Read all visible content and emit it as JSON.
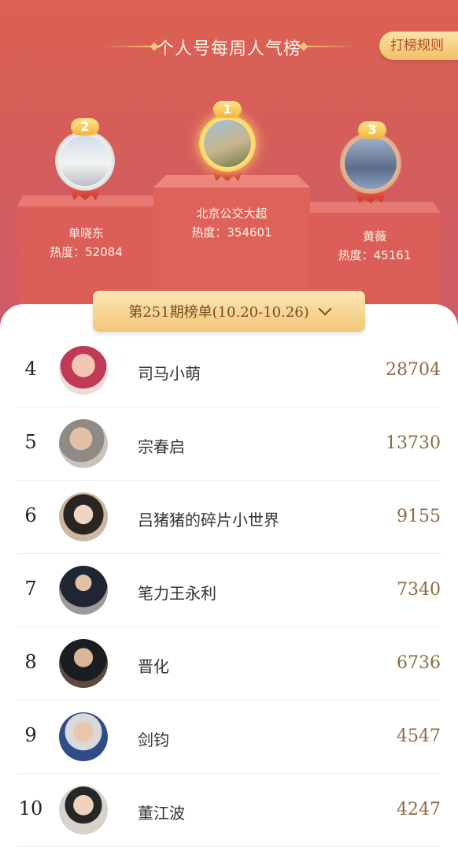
{
  "header": {
    "title": "个人号每周人气榜",
    "rules_button": "打榜规则"
  },
  "podium": [
    {
      "rank": "1",
      "name": "北京公交大超",
      "heat": "热度：354601"
    },
    {
      "rank": "2",
      "name": "单晓东",
      "heat": "热度：52084"
    },
    {
      "rank": "3",
      "name": "黄薇",
      "heat": "热度：45161"
    }
  ],
  "period": {
    "label": "第251期榜单(10.20-10.26)"
  },
  "list": [
    {
      "rank": "4",
      "name": "司马小萌",
      "score": "28704"
    },
    {
      "rank": "5",
      "name": "宗春启",
      "score": "13730"
    },
    {
      "rank": "6",
      "name": "吕猪猪的碎片小世界",
      "score": "9155"
    },
    {
      "rank": "7",
      "name": "笔力王永利",
      "score": "7340"
    },
    {
      "rank": "8",
      "name": "晋化",
      "score": "6736"
    },
    {
      "rank": "9",
      "name": "剑钧",
      "score": "4547"
    },
    {
      "rank": "10",
      "name": "董江波",
      "score": "4247"
    }
  ],
  "colors": {
    "header_bg": "#d55e5a",
    "accent_gold": "#f2c77a",
    "score_text": "#8a6d44"
  }
}
